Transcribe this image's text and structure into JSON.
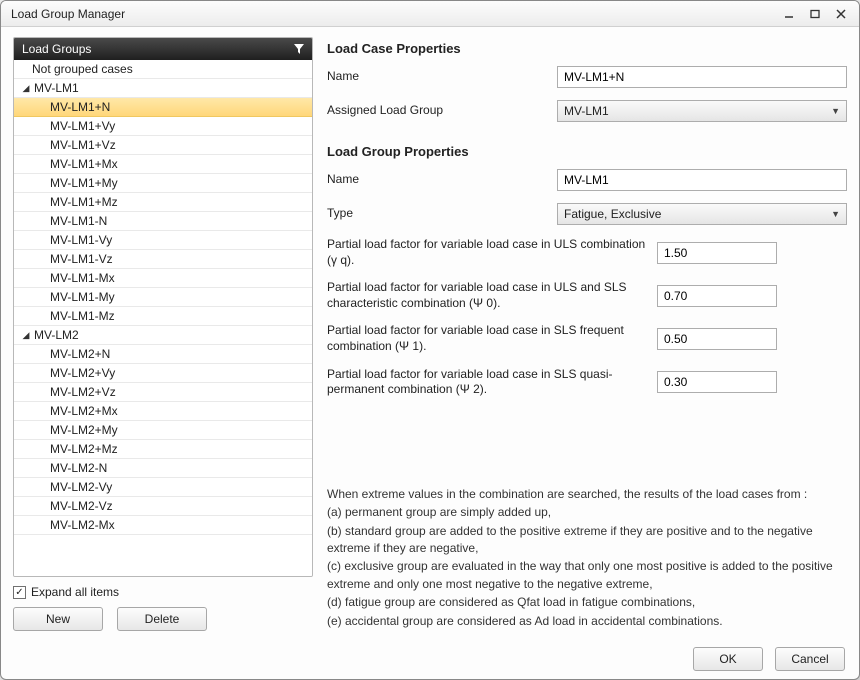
{
  "window": {
    "title": "Load Group Manager"
  },
  "sidebar": {
    "header": "Load Groups",
    "not_grouped_label": "Not grouped cases",
    "groups": [
      {
        "name": "MV-LM1",
        "expanded": true,
        "items": [
          "MV-LM1+N",
          "MV-LM1+Vy",
          "MV-LM1+Vz",
          "MV-LM1+Mx",
          "MV-LM1+My",
          "MV-LM1+Mz",
          "MV-LM1-N",
          "MV-LM1-Vy",
          "MV-LM1-Vz",
          "MV-LM1-Mx",
          "MV-LM1-My",
          "MV-LM1-Mz"
        ],
        "selected_index": 0
      },
      {
        "name": "MV-LM2",
        "expanded": true,
        "items": [
          "MV-LM2+N",
          "MV-LM2+Vy",
          "MV-LM2+Vz",
          "MV-LM2+Mx",
          "MV-LM2+My",
          "MV-LM2+Mz",
          "MV-LM2-N",
          "MV-LM2-Vy",
          "MV-LM2-Vz",
          "MV-LM2-Mx"
        ],
        "selected_index": -1
      }
    ],
    "expand_all_checked": true,
    "expand_all_label": "Expand all items",
    "new_button": "New",
    "delete_button": "Delete"
  },
  "load_case": {
    "section_title": "Load Case Properties",
    "name_label": "Name",
    "name_value": "MV-LM1+N",
    "assigned_group_label": "Assigned Load Group",
    "assigned_group_value": "MV-LM1"
  },
  "load_group": {
    "section_title": "Load Group Properties",
    "name_label": "Name",
    "name_value": "MV-LM1",
    "type_label": "Type",
    "type_value": "Fatigue, Exclusive",
    "factors": [
      {
        "label": "Partial load factor for variable load case in ULS combination (γ q).",
        "value": "1.50"
      },
      {
        "label": "Partial load factor for variable load case in ULS and SLS characteristic combination (Ψ 0).",
        "value": "0.70"
      },
      {
        "label": "Partial load factor for variable load case in SLS frequent combination (Ψ 1).",
        "value": "0.50"
      },
      {
        "label": "Partial load factor for variable load case in SLS quasi-permanent combination (Ψ 2).",
        "value": "0.30"
      }
    ]
  },
  "help": {
    "intro": "When extreme values in the combination are searched, the results of the load cases from :",
    "a": "(a) permanent group are simply added up,",
    "b": "(b) standard group are added to the positive extreme if they are positive and to the negative extreme if they are negative,",
    "c": "(c) exclusive group are evaluated in the way that only one most positive is added to the positive extreme and only one most negative to the negative extreme,",
    "d": "(d) fatigue group are considered as Qfat load in fatigue combinations,",
    "e": "(e) accidental group are considered as Ad load in accidental combinations."
  },
  "footer": {
    "ok": "OK",
    "cancel": "Cancel"
  }
}
